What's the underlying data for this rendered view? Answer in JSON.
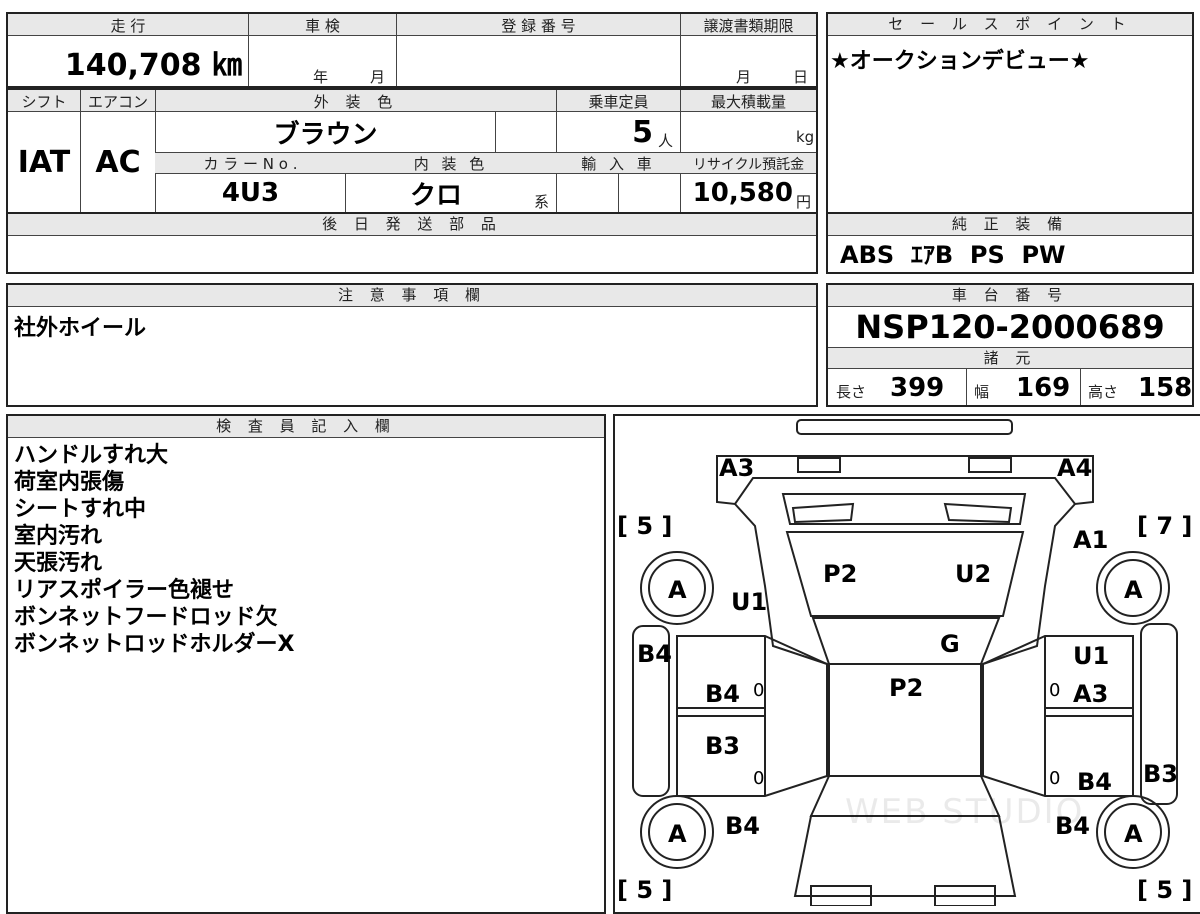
{
  "top_row": {
    "mileage_label": "走 行",
    "mileage_value": "140,708 ㎞",
    "inspection_label": "車 検",
    "inspection_year_unit": "年",
    "inspection_month_unit": "月",
    "registration_label": "登 録 番 号",
    "transfer_label": "譲渡書類期限",
    "transfer_month_unit": "月",
    "transfer_day_unit": "日"
  },
  "specs_row": {
    "shift_label": "シフト",
    "shift_value": "IAT",
    "ac_label": "エアコン",
    "ac_value": "AC",
    "exterior_label": "外 装 色",
    "exterior_value": "ブラウン",
    "capacity_label": "乗車定員",
    "capacity_value": "5",
    "capacity_unit": "人",
    "max_load_label": "最大積載量",
    "max_load_unit": "kg",
    "color_no_label": "カ ラ ー N o .",
    "color_no_value": "4U3",
    "interior_label": "内 装 色",
    "interior_value": "クロ",
    "interior_unit": "系",
    "import_label": "輸 入 車",
    "recycle_label": "リサイクル預託金",
    "recycle_value": "10,580",
    "recycle_unit": "円"
  },
  "later_parts": {
    "label": "後 日 発 送 部 品"
  },
  "sales_points": {
    "label": "セ ー ル ス ポ イ ン ト",
    "text": "★オークションデビュー★"
  },
  "genuine_equipment": {
    "label": "純 正 装 備",
    "text": "ABS  ｴｱB  PS  PW"
  },
  "notes": {
    "label": "注 意 事 項 欄",
    "text": "社外ホイール"
  },
  "chassis": {
    "label": "車 台 番 号",
    "value": "NSP120-2000689"
  },
  "dimensions": {
    "label": "諸 元",
    "length_label": "長さ",
    "length_value": "399",
    "width_label": "幅",
    "width_value": "169",
    "height_label": "高さ",
    "height_value": "158"
  },
  "inspector": {
    "label": "検 査 員 記 入 欄",
    "lines": [
      "ハンドルすれ大",
      "荷室内張傷",
      "シートすれ中",
      "室内汚れ",
      "天張汚れ",
      "リアスポイラー色褪せ",
      "ボンネットフードロッド欠",
      "ボンネットロッドホルダーX"
    ]
  },
  "diagram": {
    "marks": {
      "a3_rear_left": "A3",
      "a4_rear_right": "A4",
      "tire_rl": "A",
      "tire_rr": "A",
      "tire_fl": "A",
      "tire_fr": "A",
      "tread_rl": "[ 5 ]",
      "tread_rr": "[ 7 ]",
      "tread_fl": "[ 5 ]",
      "tread_fr": "[ 5 ]",
      "a1": "A1",
      "u1_left": "U1",
      "p2_rear": "P2",
      "u2": "U2",
      "g": "G",
      "b4_left_side": "B4",
      "b4_rl_door": "B4",
      "b3_fl_door": "B3",
      "u1_right": "U1",
      "a3_rr_door": "A3",
      "p2_roof": "P2",
      "b4_fr_door": "B4",
      "b3_right_side": "B3",
      "b4_front_left": "B4",
      "b4_front_right": "B4",
      "zero_1": "0",
      "zero_2": "0",
      "zero_3": "0",
      "zero_4": "0"
    },
    "watermark": "WEB STUDIO"
  }
}
